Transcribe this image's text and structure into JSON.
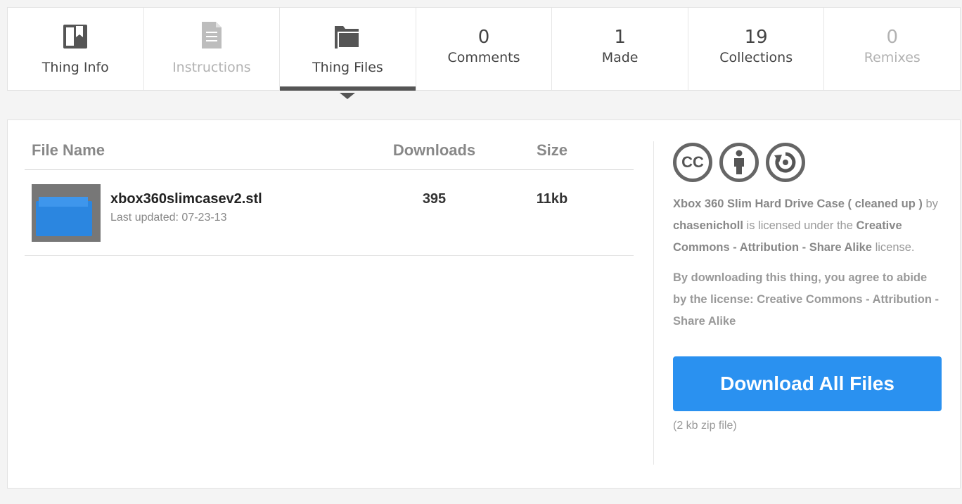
{
  "tabs": [
    {
      "label": "Thing Info",
      "icon": "bookmark-icon"
    },
    {
      "label": "Instructions",
      "icon": "document-icon"
    },
    {
      "label": "Thing Files",
      "icon": "folder-icon"
    },
    {
      "label": "Comments",
      "count": "0"
    },
    {
      "label": "Made",
      "count": "1"
    },
    {
      "label": "Collections",
      "count": "19"
    },
    {
      "label": "Remixes",
      "count": "0"
    }
  ],
  "files": {
    "headers": {
      "name": "File Name",
      "downloads": "Downloads",
      "size": "Size"
    },
    "rows": [
      {
        "name": "xbox360slimcasev2.stl",
        "updated": "Last updated: 07-23-13",
        "downloads": "395",
        "size": "11kb"
      }
    ]
  },
  "license": {
    "cc_label": "CC",
    "thing_title": "Xbox 360 Slim Hard Drive Case ( cleaned up )",
    "by": "by",
    "author": "chasenicholl",
    "licensed_under": "is licensed under the",
    "license_name": "Creative Commons - Attribution - Share Alike",
    "license_suffix": "license.",
    "agree_text": "By downloading this thing, you agree to abide by the license: Creative Commons - Attribution - Share Alike"
  },
  "download": {
    "button_label": "Download All Files",
    "zip_note": "(2 kb zip file)"
  }
}
